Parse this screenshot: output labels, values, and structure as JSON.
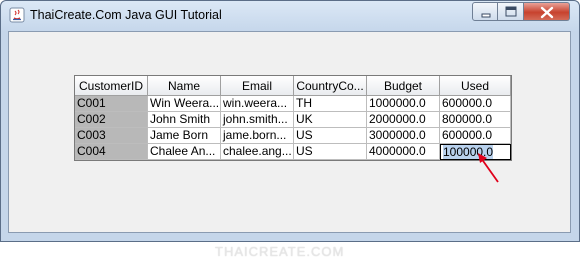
{
  "window": {
    "title": "ThaiCreate.Com Java GUI Tutorial"
  },
  "table": {
    "columns": [
      "CustomerID",
      "Name",
      "Email",
      "CountryCo...",
      "Budget",
      "Used"
    ],
    "rows": [
      [
        "C001",
        "Win Weera...",
        "win.weera...",
        "TH",
        "1000000.0",
        "600000.0"
      ],
      [
        "C002",
        "John  Smith",
        "john.smith...",
        "UK",
        "2000000.0",
        "800000.0"
      ],
      [
        "C003",
        "Jame Born",
        "jame.born...",
        "US",
        "3000000.0",
        "600000.0"
      ],
      [
        "C004",
        "Chalee An...",
        "chalee.ang...",
        "US",
        "4000000.0",
        "100000.0"
      ]
    ]
  },
  "watermark": "THAICREATE.COM",
  "colors": {
    "arrow": "#e0001a",
    "id_column_bg": "#b8b8b8",
    "selection": "#b9d2ee"
  }
}
